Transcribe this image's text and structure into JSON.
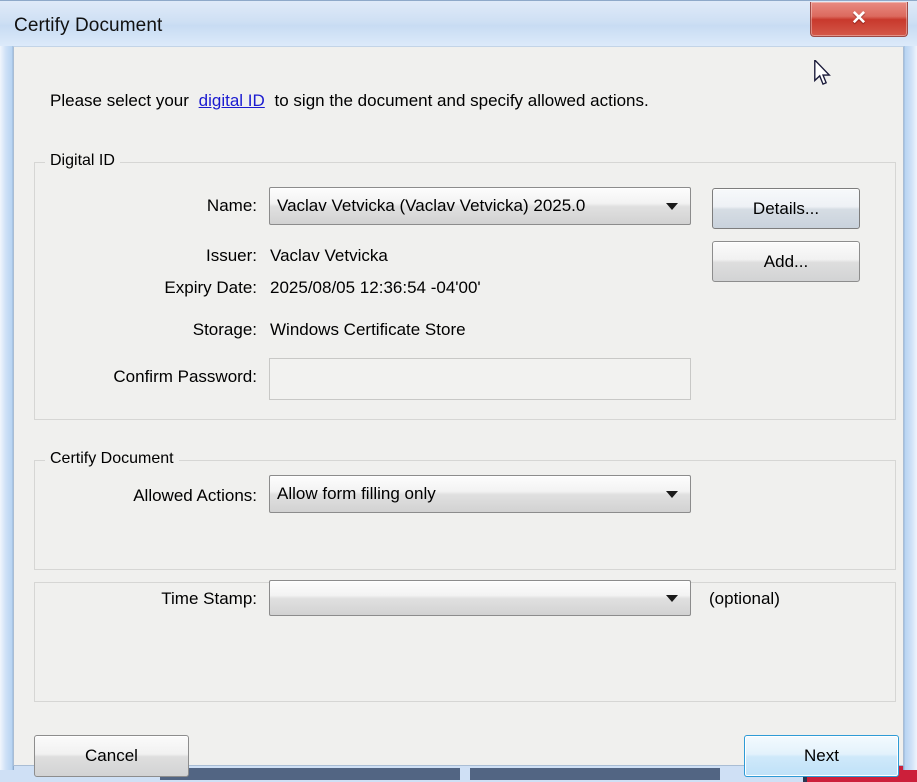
{
  "window": {
    "title": "Certify Document",
    "close_label": "✕"
  },
  "intro": {
    "before": "Please select your",
    "link": "digital ID",
    "after": "to sign the document and specify allowed actions."
  },
  "digital_id_group": {
    "legend": "Digital ID",
    "name_label": "Name:",
    "name_value": "Vaclav Vetvicka (Vaclav Vetvicka) 2025.0",
    "issuer_label": "Issuer:",
    "issuer_value": "Vaclav Vetvicka",
    "expiry_label": "Expiry Date:",
    "expiry_value": "2025/08/05 12:36:54 -04'00'",
    "storage_label": "Storage:",
    "storage_value": "Windows Certificate Store",
    "password_label": "Confirm Password:",
    "password_value": "",
    "password_placeholder": "",
    "details_button": "Details...",
    "add_button": "Add..."
  },
  "certify_group": {
    "legend": "Certify Document",
    "allowed_actions_label": "Allowed Actions:",
    "allowed_actions_value": "Allow form filling only"
  },
  "timestamp_group": {
    "time_stamp_label": "Time Stamp:",
    "time_stamp_value": "",
    "optional_note": "(optional)"
  },
  "footer": {
    "cancel_label": "Cancel",
    "next_label": "Next"
  },
  "colors": {
    "accent_blue": "#2e9bd6",
    "link_blue": "#1a1ad0",
    "close_red": "#c8392c",
    "dialog_bg": "#f0f0ee",
    "titlebar_blue": "#cfe0f4"
  }
}
